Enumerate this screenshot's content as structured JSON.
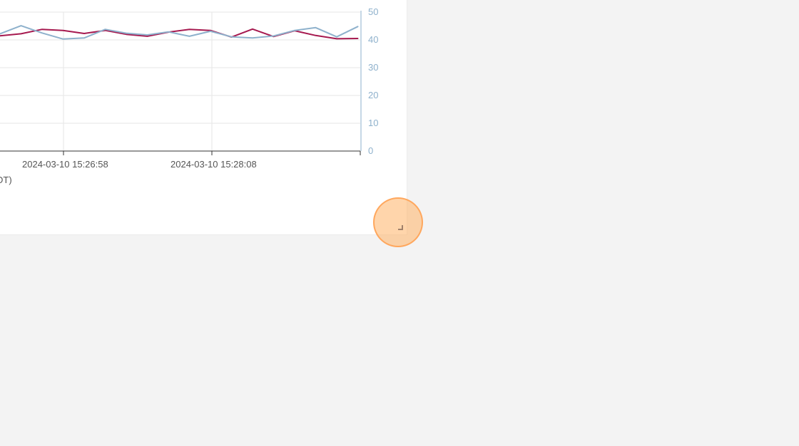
{
  "chart_data": {
    "type": "line",
    "ylim": [
      0,
      50
    ],
    "y_ticks": [
      "0",
      "10",
      "20",
      "30",
      "40",
      "50"
    ],
    "x_tick_labels": [
      "2024-03-10 15:26:58",
      "2024-03-10 15:28:08"
    ],
    "xlabel_fragment": "DT)",
    "grid": true,
    "axis_color": "#8eb1cc",
    "series": [
      {
        "color": "#a6194f",
        "values": [
          41.5,
          42.2,
          43.8,
          43.4,
          42.3,
          43.4,
          42.0,
          41.3,
          42.8,
          43.8,
          43.4,
          41.0,
          43.9,
          41.2,
          43.3,
          41.6,
          40.4,
          40.5
        ]
      },
      {
        "color": "#8eb1cc",
        "values": [
          42.2,
          45.1,
          42.5,
          40.3,
          40.7,
          43.8,
          42.4,
          41.8,
          42.9,
          41.3,
          43.1,
          41.1,
          40.7,
          41.4,
          43.4,
          44.4,
          41.1,
          44.8
        ]
      }
    ]
  }
}
